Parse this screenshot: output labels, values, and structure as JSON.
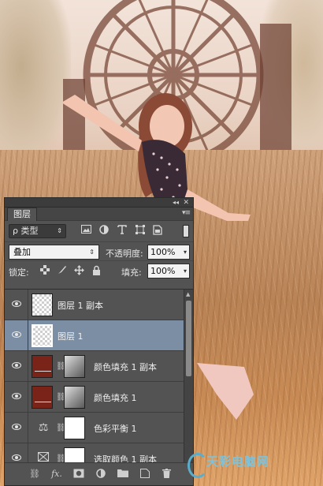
{
  "panel": {
    "tab_label": "图层",
    "collapse_glyph": "◂◂",
    "close_glyph": "✕",
    "menu_glyph": "▾≡",
    "filter": {
      "selected": "ρ 类型",
      "arrow": "⇕"
    },
    "filter_icons": [
      "image-filter-icon",
      "adjustment-filter-icon",
      "type-filter-icon",
      "shape-filter-icon",
      "smart-object-filter-icon"
    ],
    "blend_mode": "叠加",
    "opacity_label": "不透明度:",
    "opacity_value": "100%",
    "lock_label": "锁定:",
    "fill_label": "填充:",
    "fill_value": "100%",
    "layers": [
      {
        "name": "图层 1 副本",
        "visible": true,
        "selected": false,
        "kind": "pixel"
      },
      {
        "name": "图层 1",
        "visible": true,
        "selected": true,
        "kind": "pixel"
      },
      {
        "name": "颜色填充 1 副本",
        "visible": true,
        "selected": false,
        "kind": "fill",
        "color": "#7a2318"
      },
      {
        "name": "颜色填充 1",
        "visible": true,
        "selected": false,
        "kind": "fill",
        "color": "#7a2318"
      },
      {
        "name": "色彩平衡 1",
        "visible": true,
        "selected": false,
        "kind": "adjustment",
        "icon": "balance-scale-icon"
      },
      {
        "name": "选取颜色 1 副本",
        "visible": true,
        "selected": false,
        "kind": "adjustment",
        "icon": "selective-color-icon"
      }
    ],
    "bottom_icons": [
      "link-icon",
      "fx-icon",
      "mask-icon",
      "adjustment-icon",
      "folder-icon",
      "new-layer-icon",
      "trash-icon"
    ]
  },
  "watermark": {
    "text": "天彩电脑网"
  },
  "colors": {
    "panel_bg": "#535353",
    "selected_row": "#7b8ea3",
    "fill_red": "#7a2318"
  }
}
